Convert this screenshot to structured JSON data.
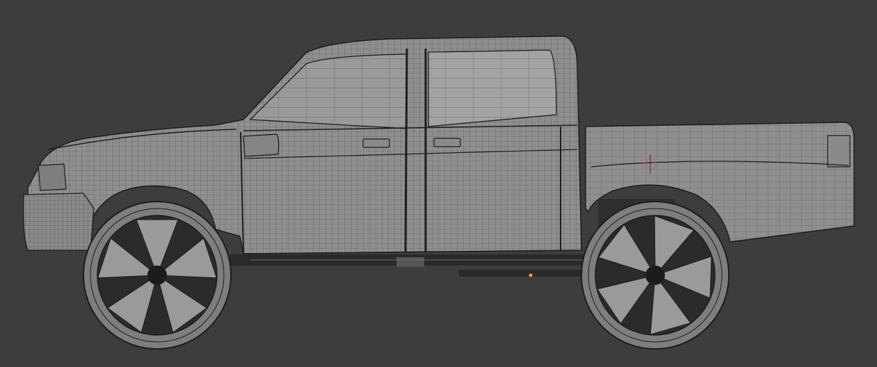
{
  "viewport": {
    "background_color": "#3d3d3d",
    "mesh_fill_color": "#8f8f8f",
    "mesh_light_color": "#a3a3a3",
    "wire_color": "#1c1c1c",
    "frame_color": "#2a2a2a",
    "cursor_color": "#e0524d",
    "light_point_color": "#ff9a2e"
  },
  "model": {
    "description_icon": "pickup-truck-wireframe",
    "wheels": [
      "front-wheel",
      "rear-wheel"
    ],
    "rim_spokes": 5
  }
}
